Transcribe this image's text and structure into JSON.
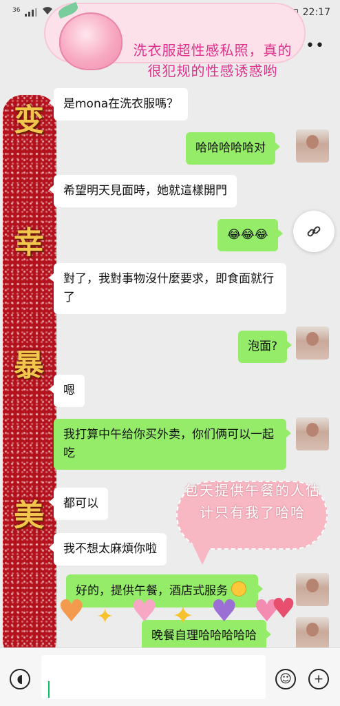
{
  "status_bar": {
    "network": "36",
    "time": "22:17"
  },
  "header": {
    "sticker_text": "洗衣服超性感私照，真的很犯规的性感诱惑哟",
    "more_icon": "more-icon"
  },
  "sidebar_sticker": {
    "chars": [
      "变",
      "幸",
      "暴",
      "美"
    ]
  },
  "messages": [
    {
      "side": "left",
      "text": "是mona在洗衣服嗎？"
    },
    {
      "side": "right",
      "text": "哈哈哈哈哈对"
    },
    {
      "side": "left",
      "text": "希望明天見面時，她就這樣開門"
    },
    {
      "side": "right",
      "text": "😂😂😂"
    },
    {
      "side": "left",
      "text": "對了，我對事物沒什麼要求，即食面就行了"
    },
    {
      "side": "right",
      "text": "泡面?"
    },
    {
      "side": "left",
      "text": "嗯"
    },
    {
      "side": "right",
      "text": "我打算中午给你买外卖，你们俩可以一起吃"
    },
    {
      "side": "left",
      "text": "都可以"
    },
    {
      "side": "left",
      "text": "我不想太麻煩你啦"
    },
    {
      "side": "right",
      "text": "好的，提供午餐，酒店式服务"
    },
    {
      "side": "right",
      "text": "晚餐自理哈哈哈哈哈"
    }
  ],
  "overlay_sticker": {
    "text": "包天提供午餐的人估计只有我了哈哈"
  },
  "input_bar": {
    "voice_icon": "voice-icon",
    "emoji_icon": "emoji-icon",
    "plus_icon": "plus-icon"
  },
  "colors": {
    "outgoing_bubble": "#95ec69",
    "incoming_bubble": "#ffffff",
    "background": "#ececec",
    "accent": "#07c160"
  }
}
